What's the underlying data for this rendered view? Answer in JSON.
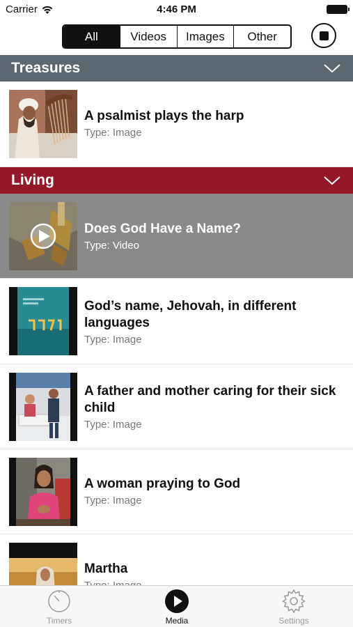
{
  "status_bar": {
    "carrier": "Carrier",
    "time": "4:46 PM"
  },
  "filter": {
    "segments": [
      "All",
      "Videos",
      "Images",
      "Other"
    ],
    "selected": "All"
  },
  "sections": [
    {
      "title": "Treasures",
      "color": "#5b6870",
      "items": [
        {
          "title": "A psalmist plays the harp",
          "type": "Type: Image"
        }
      ]
    },
    {
      "title": "Living",
      "color": "#95182a",
      "items": [
        {
          "title": "Does God Have a Name?",
          "type": "Type: Video"
        },
        {
          "title": "God’s name, Jehovah, in different languages",
          "type": "Type: Image"
        },
        {
          "title": "A father and mother caring for their sick child",
          "type": "Type: Image"
        },
        {
          "title": "A woman praying to God",
          "type": "Type: Image"
        },
        {
          "title": "Martha",
          "type": "Type: Image"
        }
      ]
    }
  ],
  "tabbar": {
    "tabs": [
      "Timers",
      "Media",
      "Settings"
    ],
    "active": "Media"
  },
  "colors": {
    "selected_row": "#8a8a8a",
    "accent": "#111111"
  }
}
